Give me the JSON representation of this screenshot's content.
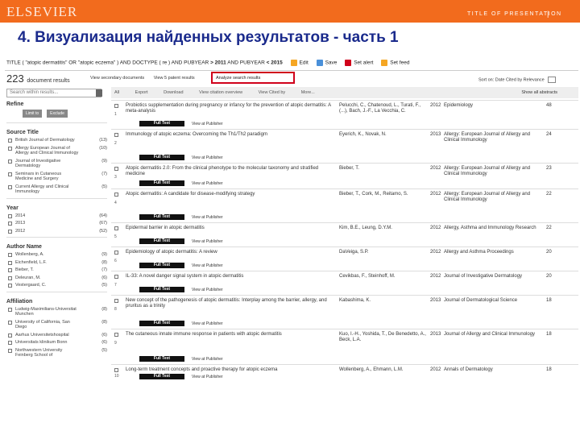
{
  "header": {
    "logo": "ELSEVIER",
    "presentation_label": "TITLE OF PRESENTATION",
    "separator": "|",
    "slide_title": "4. Визуализация найденных результатов - часть 1",
    "accent_color": "#f26b1d",
    "title_color": "#1a2a8c"
  },
  "query": {
    "text_start": "TITLE ( \"atopic dermatitis\" OR \"atopic eczema\" ) AND DOCTYPE ( re ) AND PUBYEAR",
    "op1": ">",
    "year1": "2011",
    "mid": "AND PUBYEAR",
    "op2": "<",
    "year2": "2015",
    "edit": "Edit",
    "save": "Save",
    "set_alert": "Set alert",
    "set_feed": "Set feed"
  },
  "results_header": {
    "count": "223",
    "count_label": "document results",
    "view_secondary": "View secondary documents",
    "view_patent": "View 5 patent results",
    "analyze": "Analyze search results",
    "sort_label": "Sort on:",
    "sort_date": "Date",
    "sort_cited": "Cited by",
    "sort_relevance": "Relevance"
  },
  "search_within": {
    "placeholder": "Search within results..."
  },
  "sidebar": {
    "refine": "Refine",
    "limit_to": "Limit to",
    "exclude": "Exclude",
    "source_title": {
      "heading": "Source Title",
      "items": [
        {
          "label": "British Journal of Dermatology",
          "count": "(13)"
        },
        {
          "label": "Allergy European Journal of Allergy and Clinical Immunology",
          "count": "(10)"
        },
        {
          "label": "Journal of Investigative Dermatology",
          "count": "(9)"
        },
        {
          "label": "Seminars in Cutaneous Medicine and Surgery",
          "count": "(7)"
        },
        {
          "label": "Current Allergy and Clinical Immunology",
          "count": "(5)"
        }
      ]
    },
    "year": {
      "heading": "Year",
      "items": [
        {
          "label": "2014",
          "count": "(64)"
        },
        {
          "label": "2013",
          "count": "(67)"
        },
        {
          "label": "2012",
          "count": "(52)"
        }
      ]
    },
    "author": {
      "heading": "Author Name",
      "items": [
        {
          "label": "Wollenberg, A.",
          "count": "(9)"
        },
        {
          "label": "Eichenfield, L.F.",
          "count": "(8)"
        },
        {
          "label": "Bieber, T.",
          "count": "(7)"
        },
        {
          "label": "Deleuran, M.",
          "count": "(6)"
        },
        {
          "label": "Vestergaard, C.",
          "count": "(5)"
        }
      ]
    },
    "affiliation": {
      "heading": "Affiliation",
      "items": [
        {
          "label": "Ludwig-Maximilians-Universitat Munchen",
          "count": "(8)"
        },
        {
          "label": "University of California, San Diego",
          "count": "(8)"
        },
        {
          "label": "Aarhus Universitetshospital",
          "count": "(6)"
        },
        {
          "label": "Universitats klinikum Bonn",
          "count": "(6)"
        },
        {
          "label": "Northwestern University Feinberg School of",
          "count": "(5)"
        }
      ]
    }
  },
  "selection_bar": {
    "all": "All",
    "export": "Export",
    "download": "Download",
    "view_citation": "View citation overview",
    "view_cited": "View Cited by",
    "more": "More...",
    "show_abstracts": "Show all abstracts"
  },
  "result_buttons": {
    "full_text": "Full Text",
    "view_publisher": "View at Publisher"
  },
  "results": [
    {
      "num": "1",
      "title": "Probiotics supplementation during pregnancy or infancy for the prevention of atopic dermatitis: A meta-analysis",
      "authors": "Pelucchi, C., Chatenoud, L., Turati, F., (...), Bach, J.-F., La Vecchia, C.",
      "year": "2012",
      "source": "Epidemiology",
      "cited": "48"
    },
    {
      "num": "2",
      "title": "Immunology of atopic eczema: Overcoming the Th1/Th2 paradigm",
      "authors": "Eyerich, K., Novak, N.",
      "year": "2013",
      "source": "Allergy: European Journal of Allergy and Clinical Immunology",
      "cited": "24"
    },
    {
      "num": "3",
      "title": "Atopic dermatitis 2.0: From the clinical phenotype to the molecular taxonomy and stratified medicine",
      "authors": "Bieber, T.",
      "year": "2012",
      "source": "Allergy: European Journal of Allergy and Clinical Immunology",
      "cited": "23"
    },
    {
      "num": "4",
      "title": "Atopic dermatitis: A candidate for disease-modifying strategy",
      "authors": "Bieber, T., Cork, M., Reitamo, S.",
      "year": "2012",
      "source": "Allergy: European Journal of Allergy and Clinical Immunology",
      "cited": "22"
    },
    {
      "num": "5",
      "title": "Epidermal barrier in atopic dermatitis",
      "authors": "Kim, B.E., Leung, D.Y.M.",
      "year": "2012",
      "source": "Allergy, Asthma and Immunology Research",
      "cited": "22"
    },
    {
      "num": "6",
      "title": "Epidemiology of atopic dermatitis: A review",
      "authors": "DaVeiga, S.P.",
      "year": "2012",
      "source": "Allergy and Asthma Proceedings",
      "cited": "20"
    },
    {
      "num": "7",
      "title": "IL-33: A novel danger signal system in atopic dermatitis",
      "authors": "Cevikbas, F., Steinhoff, M.",
      "year": "2012",
      "source": "Journal of Investigative Dermatology",
      "cited": "20"
    },
    {
      "num": "8",
      "title": "New concept of the pathogenesis of atopic dermatitis: Interplay among the barrier, allergy, and pruritus as a trinity",
      "authors": "Kabashima, K.",
      "year": "2013",
      "source": "Journal of Dermatological Science",
      "cited": "18"
    },
    {
      "num": "9",
      "title": "The cutaneous innate immune response in patients with atopic dermatitis",
      "authors": "Kuo, I.-H., Yoshida, T., De Benedetto, A., Beck, L.A.",
      "year": "2013",
      "source": "Journal of Allergy and Clinical Immunology",
      "cited": "18"
    },
    {
      "num": "10",
      "title": "Long-term treatment concepts and proactive therapy for atopic eczema",
      "authors": "Wollenberg, A., Ehmann, L.M.",
      "year": "2012",
      "source": "Annals of Dermatology",
      "cited": "18"
    }
  ]
}
